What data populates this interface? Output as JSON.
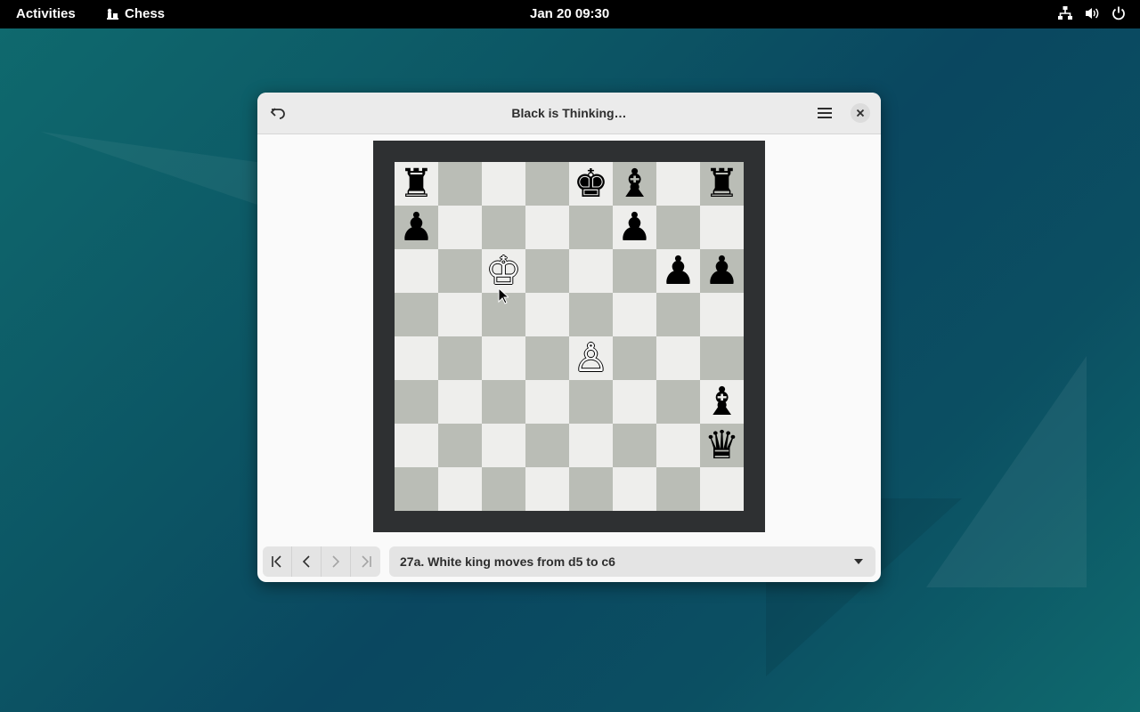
{
  "topbar": {
    "activities": "Activities",
    "app_name": "Chess",
    "clock": "Jan 20  09:30",
    "tray_icons": [
      "network-icon",
      "volume-icon",
      "power-icon"
    ]
  },
  "window": {
    "title": "Black is Thinking…",
    "board": {
      "rows": [
        [
          {
            "p": "♜",
            "c": "b"
          },
          {
            "p": "",
            "c": ""
          },
          {
            "p": "",
            "c": ""
          },
          {
            "p": "",
            "c": ""
          },
          {
            "p": "♚",
            "c": "b"
          },
          {
            "p": "♝",
            "c": "b"
          },
          {
            "p": "",
            "c": ""
          },
          {
            "p": "♜",
            "c": "b"
          }
        ],
        [
          {
            "p": "♟",
            "c": "b"
          },
          {
            "p": "",
            "c": ""
          },
          {
            "p": "",
            "c": ""
          },
          {
            "p": "",
            "c": ""
          },
          {
            "p": "",
            "c": ""
          },
          {
            "p": "♟",
            "c": "b"
          },
          {
            "p": "",
            "c": ""
          },
          {
            "p": "",
            "c": ""
          }
        ],
        [
          {
            "p": "",
            "c": ""
          },
          {
            "p": "",
            "c": ""
          },
          {
            "p": "♔",
            "c": "w"
          },
          {
            "p": "",
            "c": ""
          },
          {
            "p": "",
            "c": ""
          },
          {
            "p": "",
            "c": ""
          },
          {
            "p": "♟",
            "c": "b"
          },
          {
            "p": "♟",
            "c": "b"
          }
        ],
        [
          {
            "p": "",
            "c": ""
          },
          {
            "p": "",
            "c": ""
          },
          {
            "p": "",
            "c": ""
          },
          {
            "p": "",
            "c": ""
          },
          {
            "p": "",
            "c": ""
          },
          {
            "p": "",
            "c": ""
          },
          {
            "p": "",
            "c": ""
          },
          {
            "p": "",
            "c": ""
          }
        ],
        [
          {
            "p": "",
            "c": ""
          },
          {
            "p": "",
            "c": ""
          },
          {
            "p": "",
            "c": ""
          },
          {
            "p": "",
            "c": ""
          },
          {
            "p": "♙",
            "c": "w"
          },
          {
            "p": "",
            "c": ""
          },
          {
            "p": "",
            "c": ""
          },
          {
            "p": "",
            "c": ""
          }
        ],
        [
          {
            "p": "",
            "c": ""
          },
          {
            "p": "",
            "c": ""
          },
          {
            "p": "",
            "c": ""
          },
          {
            "p": "",
            "c": ""
          },
          {
            "p": "",
            "c": ""
          },
          {
            "p": "",
            "c": ""
          },
          {
            "p": "",
            "c": ""
          },
          {
            "p": "♝",
            "c": "b"
          }
        ],
        [
          {
            "p": "",
            "c": ""
          },
          {
            "p": "",
            "c": ""
          },
          {
            "p": "",
            "c": ""
          },
          {
            "p": "",
            "c": ""
          },
          {
            "p": "",
            "c": ""
          },
          {
            "p": "",
            "c": ""
          },
          {
            "p": "",
            "c": ""
          },
          {
            "p": "♛",
            "c": "b"
          }
        ],
        [
          {
            "p": "",
            "c": ""
          },
          {
            "p": "",
            "c": ""
          },
          {
            "p": "",
            "c": ""
          },
          {
            "p": "",
            "c": ""
          },
          {
            "p": "",
            "c": ""
          },
          {
            "p": "",
            "c": ""
          },
          {
            "p": "",
            "c": ""
          },
          {
            "p": "",
            "c": ""
          }
        ]
      ]
    },
    "history_nav": [
      "first-move",
      "previous-move",
      "next-move",
      "last-move"
    ],
    "current_move": "27a. White king moves from d5 to c6"
  }
}
